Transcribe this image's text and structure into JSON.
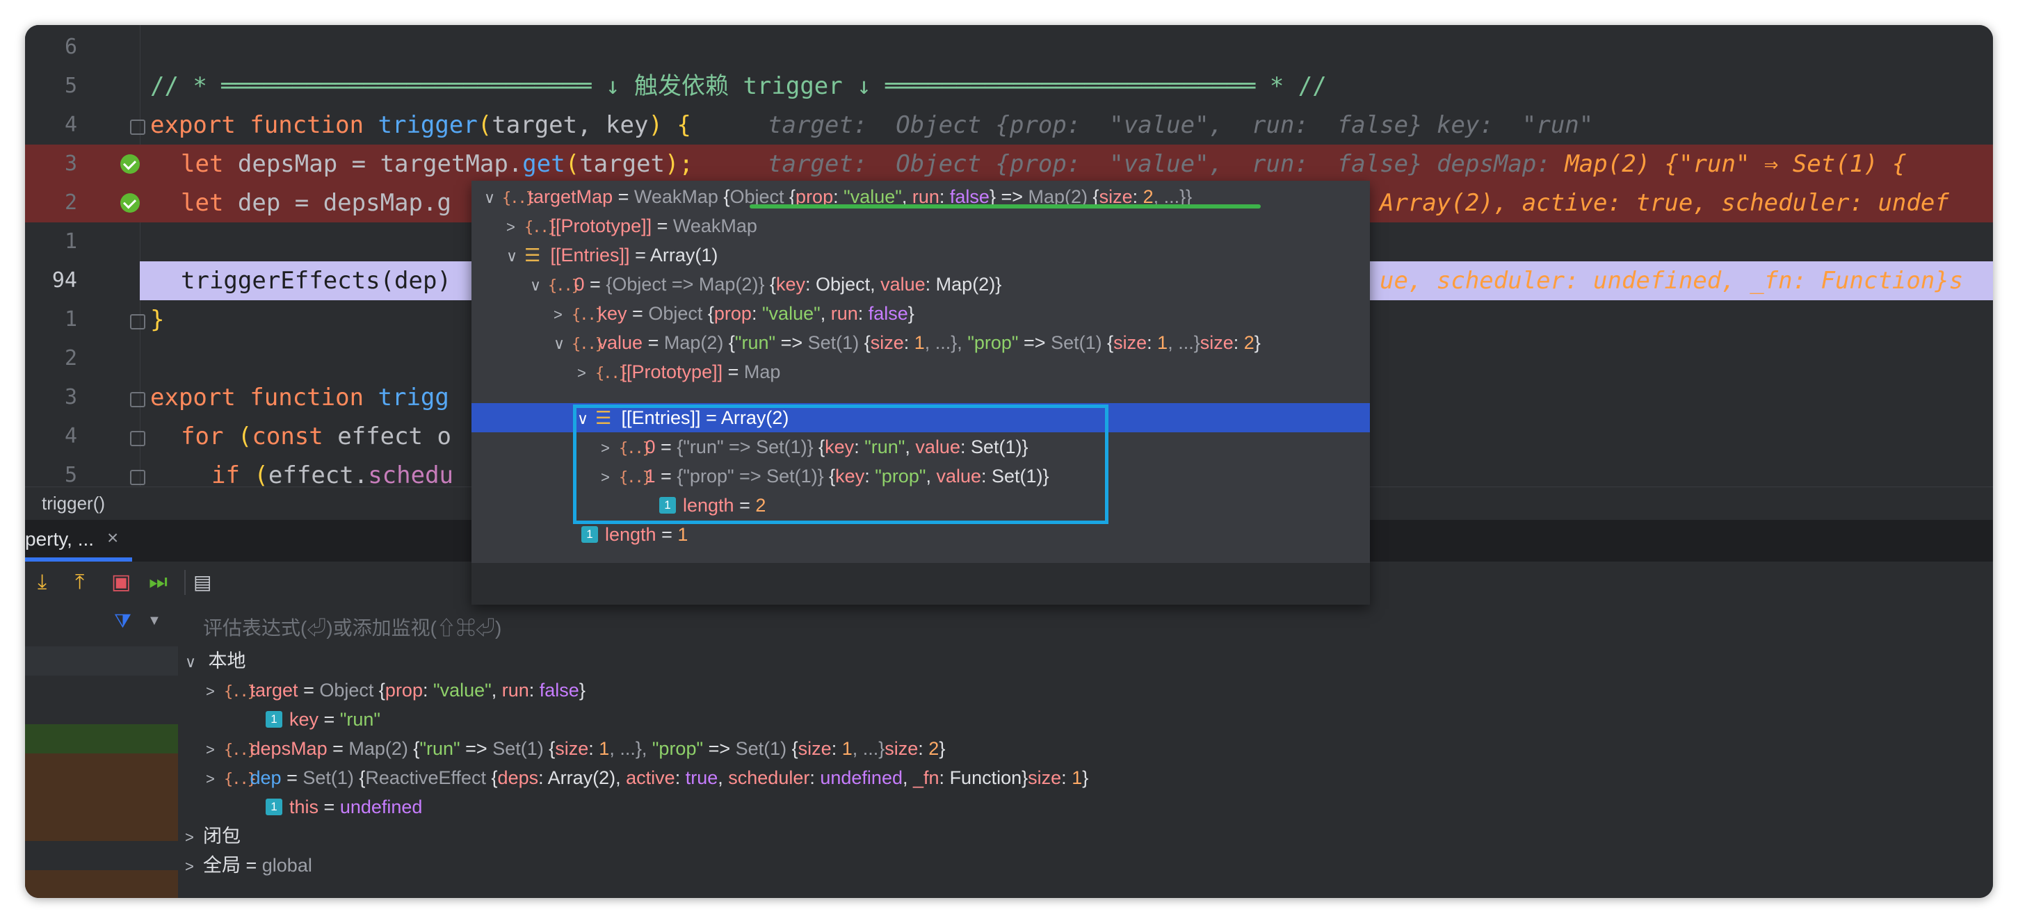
{
  "editor": {
    "lines": [
      {
        "num": "6",
        "code": ""
      },
      {
        "num": "5",
        "code": "// * ══════════════════════════ ↓ 触发依赖 trigger ↓ ══════════════════════════ * //"
      },
      {
        "num": "4",
        "kw": "export function ",
        "fn": "trigger",
        "paren_open": "(",
        "params": "target, key",
        "paren_close": ")",
        "brace": " {",
        "hint": "target:  Object {prop:  \"value\",  run:  false} key:  \"run\""
      },
      {
        "num": "3",
        "kw": "let ",
        "code": "depsMap = targetMap.",
        "fn": "get",
        "paren_open": "(",
        "params": "target",
        "paren_close": ");",
        "hint": "target:  Object {prop:  \"value\",  run:  false} depsMap:",
        "hint_orange": " Map(2) {\"run\" ⇒ Set(1) {"
      },
      {
        "num": "2",
        "kw": "let ",
        "code": "dep = depsMap.g",
        "hint_orange": "Array(2), active: true, scheduler: undef"
      },
      {
        "num": "1",
        "code": ""
      },
      {
        "num": "94",
        "code": "triggerEffects(dep)",
        "hint_orange": "ue, scheduler: undefined, _fn: Function}s"
      },
      {
        "num": "1",
        "brace": "}"
      },
      {
        "num": "2",
        "code": ""
      },
      {
        "num": "3",
        "kw": "export function ",
        "fn": "trigg"
      },
      {
        "num": "4",
        "kw": "for ",
        "paren_open": "(",
        "kw2": "const ",
        "code": "effect o"
      },
      {
        "num": "5",
        "kw": "if ",
        "paren_open": "(",
        "code": "effect.",
        "fn": "schedu"
      }
    ]
  },
  "breadcrumb": "trigger()",
  "debug_tab": {
    "label": "perty, ...",
    "close": "×"
  },
  "toolbar_icons": [
    "step-into-icon",
    "step-out-icon",
    "stop-icon",
    "resume-icon",
    "console-icon"
  ],
  "eval_placeholder": "评估表达式(⏎)或添加监视(⇧⌘⏎)",
  "popup": {
    "root": {
      "name": "targetMap",
      "eq": " = ",
      "type": "WeakMap ",
      "b1": "{",
      "obj": "Object ",
      "b2": "{",
      "k1": "prop",
      "c1": ": ",
      "v1": "\"value\"",
      "sep1": ", ",
      "k2": "run",
      "c2": ": ",
      "v2": "false",
      "b3": "}",
      "arrow": " => ",
      "map": "Map(2) ",
      "b4": "{",
      "k3": "size",
      "c3": ": ",
      "v3": "2",
      "tail": ", ...}}"
    },
    "proto1": {
      "name": "[[Prototype]]",
      "eq": " = ",
      "type": "WeakMap"
    },
    "entries1": {
      "name": "[[Entries]]",
      "eq": " = ",
      "type": "Array(1)"
    },
    "item0": {
      "name": "0",
      "eq": " = ",
      "summary": "{Object => Map(2)} ",
      "b1": "{",
      "k1": "key",
      "c1": ": ",
      "v1": "Object",
      "sep": ", ",
      "k2": "value",
      "c2": ": ",
      "v2": "Map(2)",
      "b2": "}"
    },
    "key": {
      "name": "key",
      "eq": " = ",
      "type": "Object ",
      "b1": "{",
      "k1": "prop",
      "c1": ": ",
      "v1": "\"value\"",
      "sep": ", ",
      "k2": "run",
      "c2": ": ",
      "v2": "false",
      "b2": "}"
    },
    "value": {
      "name": "value",
      "eq": " = ",
      "type": "Map(2) ",
      "b1": "{",
      "s1": "\"run\"",
      "arrow1": " => ",
      "set1": "Set(1) ",
      "b2": "{",
      "k1": "size",
      "c1": ": ",
      "v1": "1",
      "t1": ", ...}, ",
      "s2": "\"prop\"",
      "arrow2": " => ",
      "set2": "Set(1) ",
      "b3": "{",
      "k2": "size",
      "c2": ": ",
      "v2": "1",
      "t2": ", ...}",
      "k3": "size",
      "c3": ": ",
      "v3": "2",
      "b4": "}"
    },
    "proto2": {
      "name": "[[Prototype]]",
      "eq": " = ",
      "type": "Map"
    },
    "entries2": {
      "name": "[[Entries]]",
      "eq": " = ",
      "type": "Array(2)"
    },
    "e0": {
      "name": "0",
      "eq": " = ",
      "summary": "{\"run\" => Set(1)} ",
      "b1": "{",
      "k1": "key",
      "c1": ": ",
      "v1": "\"run\"",
      "sep": ", ",
      "k2": "value",
      "c2": ": ",
      "v2": "Set(1)",
      "b2": "}"
    },
    "e1": {
      "name": "1",
      "eq": " = ",
      "summary": "{\"prop\" => Set(1)} ",
      "b1": "{",
      "k1": "key",
      "c1": ": ",
      "v1": "\"prop\"",
      "sep": ", ",
      "k2": "value",
      "c2": ": ",
      "v2": "Set(1)",
      "b2": "}"
    },
    "len2": {
      "name": "length",
      "eq": " = ",
      "val": "2"
    },
    "len1": {
      "name": "length",
      "eq": " = ",
      "val": "1"
    }
  },
  "variables": {
    "local_label": "本地",
    "target": {
      "name": "target",
      "eq": " = ",
      "type": "Object ",
      "b1": "{",
      "k1": "prop",
      "c1": ": ",
      "v1": "\"value\"",
      "sep": ", ",
      "k2": "run",
      "c2": ": ",
      "v2": "false",
      "b2": "}"
    },
    "key": {
      "name": "key",
      "eq": " = ",
      "val": "\"run\""
    },
    "depsMap": {
      "name": "depsMap",
      "eq": " = ",
      "type": "Map(2) ",
      "b1": "{",
      "s1": "\"run\"",
      "arrow1": " => ",
      "set1": "Set(1) ",
      "b2": "{",
      "k1": "size",
      "c1": ": ",
      "v1": "1",
      "t1": ", ...}, ",
      "s2": "\"prop\"",
      "arrow2": " => ",
      "set2": "Set(1) ",
      "b3": "{",
      "k2": "size",
      "c2": ": ",
      "v2": "1",
      "t2": ", ...}",
      "k3": "size",
      "c3": ": ",
      "v3": "2",
      "b4": "}"
    },
    "dep": {
      "name": "dep",
      "eq": " = ",
      "type": "Set(1) ",
      "b1": "{",
      "cls": "ReactiveEffect ",
      "b2": "{",
      "k1": "deps",
      "c1": ": ",
      "v1": "Array(2)",
      "sep1": ", ",
      "k2": "active",
      "c2": ": ",
      "v2": "true",
      "sep2": ", ",
      "k3": "scheduler",
      "c3": ": ",
      "v3": "undefined",
      "sep3": ", ",
      "k4": "_fn",
      "c4": ": ",
      "v4": "Function",
      "b3": "}",
      "k5": "size",
      "c5": ": ",
      "v5": "1",
      "b4": "}"
    },
    "this": {
      "name": "this",
      "eq": " = ",
      "val": "undefined"
    },
    "closure_label": "闭包",
    "global": {
      "name": "全局",
      "eq": " = ",
      "val": "global"
    }
  },
  "colors": {
    "accent": "#3574f0",
    "highlight_red": "#6e2b2b",
    "highlight_lilac": "#c6c0f2",
    "selection": "#2e55c7",
    "box": "#1aa6e3",
    "underline": "#3db34a"
  }
}
